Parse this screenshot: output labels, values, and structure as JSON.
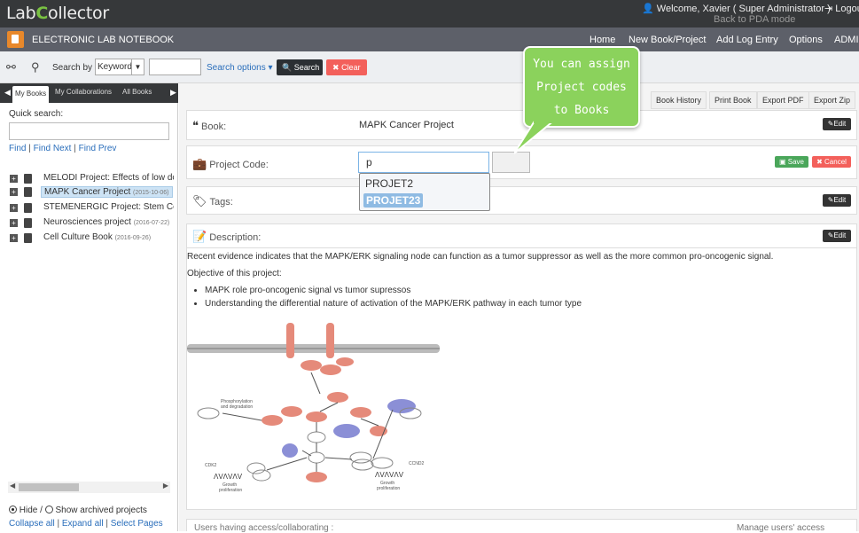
{
  "app": {
    "logo": "LabCollector",
    "logo_prefix": "Lab",
    "logo_c": "C",
    "logo_suffix": "ollector"
  },
  "topbar": {
    "welcome": "Welcome, Xavier ( Super Administrator )",
    "logout": "Logout",
    "pda": "Back to PDA mode"
  },
  "navbar": {
    "title": "ELECTRONIC LAB NOTEBOOK",
    "links": [
      "Home",
      "New Book/Project",
      "Add Log Entry",
      "Options",
      "ADMIN"
    ]
  },
  "search": {
    "label": "Search by",
    "field": "Keyword",
    "options": "Search options ▾",
    "search_btn": "Search",
    "clear_btn": "Clear"
  },
  "sidebar": {
    "tabs": [
      "My Books",
      "My Collaborations",
      "All Books"
    ],
    "quick_search": "Quick search:",
    "find": "Find",
    "find_next": "Find Next",
    "find_prev": "Find Prev",
    "items": [
      {
        "label": "MELODI Project: Effects of low dose",
        "date": ""
      },
      {
        "label": "MAPK Cancer Project",
        "date": "(2015-10-06)"
      },
      {
        "label": "STEMENERGIC Project: Stem Cell",
        "date": ""
      },
      {
        "label": "Neurosciences project",
        "date": "(2016-07-22)"
      },
      {
        "label": "Cell Culture Book",
        "date": "(2016-09-26)"
      }
    ],
    "hide": "Hide /",
    "show_archived": "Show archived projects",
    "collapse_all": "Collapse all",
    "expand_all": "Expand all",
    "select_pages": "Select Pages"
  },
  "toolbar": [
    "Book History",
    "Print Book",
    "Export PDF",
    "Export Zip"
  ],
  "book": {
    "label": "Book:",
    "value": "MAPK Cancer Project",
    "edit": "Edit"
  },
  "project_code": {
    "label": "Project Code:",
    "input": "p",
    "options": [
      "PROJET2",
      "PROJET23"
    ],
    "save": "Save",
    "cancel": "Cancel"
  },
  "tags": {
    "label": "Tags:",
    "edit": "Edit"
  },
  "description": {
    "label": "Description:",
    "edit": "Edit",
    "intro": "Recent evidence indicates that the MAPK/ERK signaling node can function as a tumor suppressor as well as the more common pro-oncogenic signal.",
    "objective": "Objective of this project:",
    "bullets": [
      "MAPK role pro-oncogenic signal vs tumor supressos",
      "Understanding the differential nature of activation of the MAPK/ERK pathway in each tumor type"
    ]
  },
  "callout": {
    "line1": "You can assign",
    "line2": "Project codes",
    "line3": "to Books"
  },
  "bottom": {
    "users": "Users having access/collaborating :",
    "manage": "Manage users' access"
  },
  "colors": {
    "accent": "#2a6ebb",
    "nav": "#5d6069",
    "top": "#36383a",
    "callout": "#8bd25c",
    "danger": "#f3605b",
    "success": "#4aa65a"
  }
}
